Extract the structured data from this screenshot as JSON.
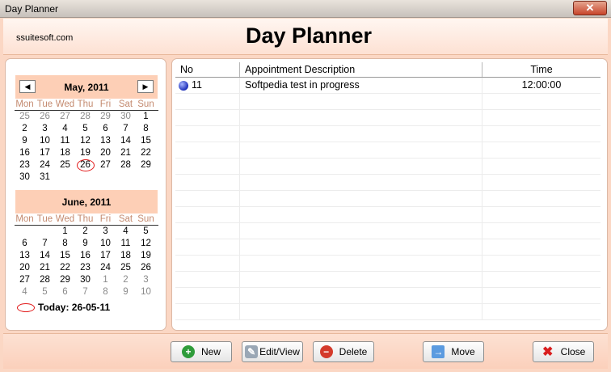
{
  "window": {
    "title": "Day Planner",
    "close_glyph": "✕"
  },
  "header": {
    "site": "ssuitesoft.com",
    "title": "Day Planner"
  },
  "calendar": {
    "dow": [
      "Mon",
      "Tue",
      "Wed",
      "Thu",
      "Fri",
      "Sat",
      "Sun"
    ],
    "may": {
      "name": "May, 2011",
      "prev": "◀",
      "next": "▶",
      "weeks": [
        [
          "25",
          "26",
          "27",
          "28",
          "29",
          "30",
          "1"
        ],
        [
          "2",
          "3",
          "4",
          "5",
          "6",
          "7",
          "8"
        ],
        [
          "9",
          "10",
          "11",
          "12",
          "13",
          "14",
          "15"
        ],
        [
          "16",
          "17",
          "18",
          "19",
          "20",
          "21",
          "22"
        ],
        [
          "23",
          "24",
          "25",
          "26",
          "27",
          "28",
          "29"
        ],
        [
          "30",
          "31",
          "",
          "",
          "",
          "",
          ""
        ]
      ]
    },
    "june": {
      "name": "June, 2011",
      "weeks": [
        [
          "",
          "",
          "1",
          "2",
          "3",
          "4",
          "5"
        ],
        [
          "6",
          "7",
          "8",
          "9",
          "10",
          "11",
          "12"
        ],
        [
          "13",
          "14",
          "15",
          "16",
          "17",
          "18",
          "19"
        ],
        [
          "20",
          "21",
          "22",
          "23",
          "24",
          "25",
          "26"
        ],
        [
          "27",
          "28",
          "29",
          "30",
          "1",
          "2",
          "3"
        ],
        [
          "4",
          "5",
          "6",
          "7",
          "8",
          "9",
          "10"
        ]
      ]
    },
    "today_label": "Today: 26-05-11"
  },
  "appointments": {
    "columns": [
      "No",
      "Appointment Description",
      "Time"
    ],
    "rows": [
      {
        "no": "11",
        "desc": "Softpedia test in progress",
        "time": "12:00:00"
      }
    ]
  },
  "buttons": {
    "new": "New",
    "edit": "Edit/View",
    "delete": "Delete",
    "move": "Move",
    "close": "Close"
  },
  "icons": {
    "new_glyph": "+",
    "delete_glyph": "−",
    "move_glyph": "→",
    "close_glyph": "✖",
    "edit_glyph": "✎"
  },
  "colors": {
    "accent": "#fbd7c4",
    "month_header": "#fdcfb6",
    "today_ring": "#e21b1b"
  }
}
